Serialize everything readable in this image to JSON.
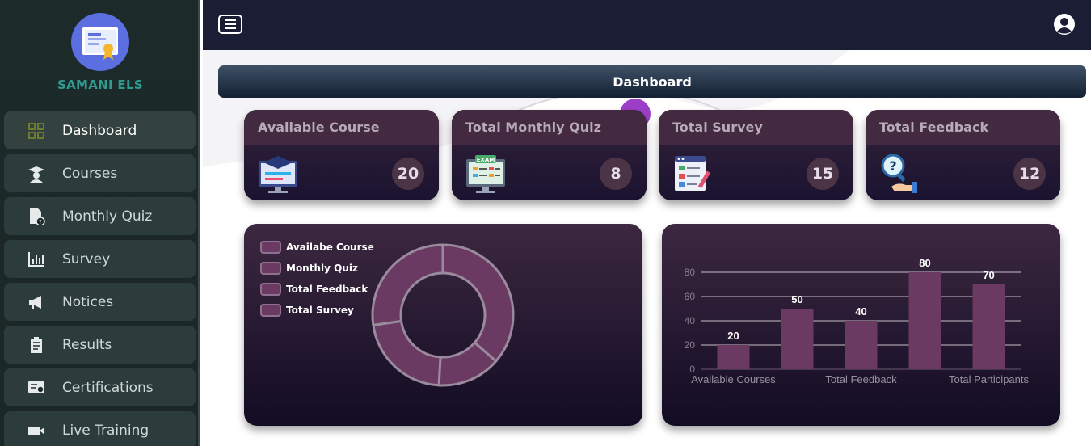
{
  "brand": {
    "name": "SAMANI ELS"
  },
  "sidebar": {
    "items": [
      {
        "label": "Dashboard",
        "icon": "dashboard-grid-icon",
        "active": true
      },
      {
        "label": "Courses",
        "icon": "graduate-icon"
      },
      {
        "label": "Monthly Quiz",
        "icon": "quiz-document-icon"
      },
      {
        "label": "Survey",
        "icon": "bar-chart-icon"
      },
      {
        "label": "Notices",
        "icon": "megaphone-icon"
      },
      {
        "label": "Results",
        "icon": "results-clipboard-icon"
      },
      {
        "label": "Certifications",
        "icon": "certificate-icon"
      },
      {
        "label": "Live Training",
        "icon": "video-camera-icon"
      }
    ]
  },
  "header": {
    "title": "Dashboard"
  },
  "cards": [
    {
      "title": "Available Course",
      "count": "20",
      "icon": "course-monitor-icon"
    },
    {
      "title": "Total Monthly Quiz",
      "count": "8",
      "icon": "exam-monitor-icon"
    },
    {
      "title": "Total Survey",
      "count": "15",
      "icon": "survey-checklist-icon"
    },
    {
      "title": "Total Feedback",
      "count": "12",
      "icon": "feedback-magnifier-icon"
    }
  ],
  "colors": {
    "sidebar_bg": "#1d2a2a",
    "brand_text": "#2f9a8f",
    "topbar_bg": "#1a1d33",
    "card_header": "#432a40",
    "chart_fill": "#6a3a62"
  },
  "chart_data": [
    {
      "type": "pie",
      "subtype": "doughnut",
      "legend": [
        "Availabe Course",
        "Monthly Quiz",
        "Total Feedback",
        "Total Survey"
      ],
      "values": [
        20,
        8,
        12,
        15
      ],
      "legend_position": "top-left"
    },
    {
      "type": "bar",
      "categories": [
        "Available Courses",
        "",
        "Total Feedback",
        "",
        "Total Participants"
      ],
      "values": [
        20,
        50,
        40,
        80,
        70
      ],
      "data_labels": [
        "20",
        "50",
        "40",
        "80",
        "70"
      ],
      "ylim": [
        0,
        80
      ],
      "yticks": [
        "0",
        "20",
        "40",
        "60",
        "80"
      ],
      "grid": true
    }
  ]
}
